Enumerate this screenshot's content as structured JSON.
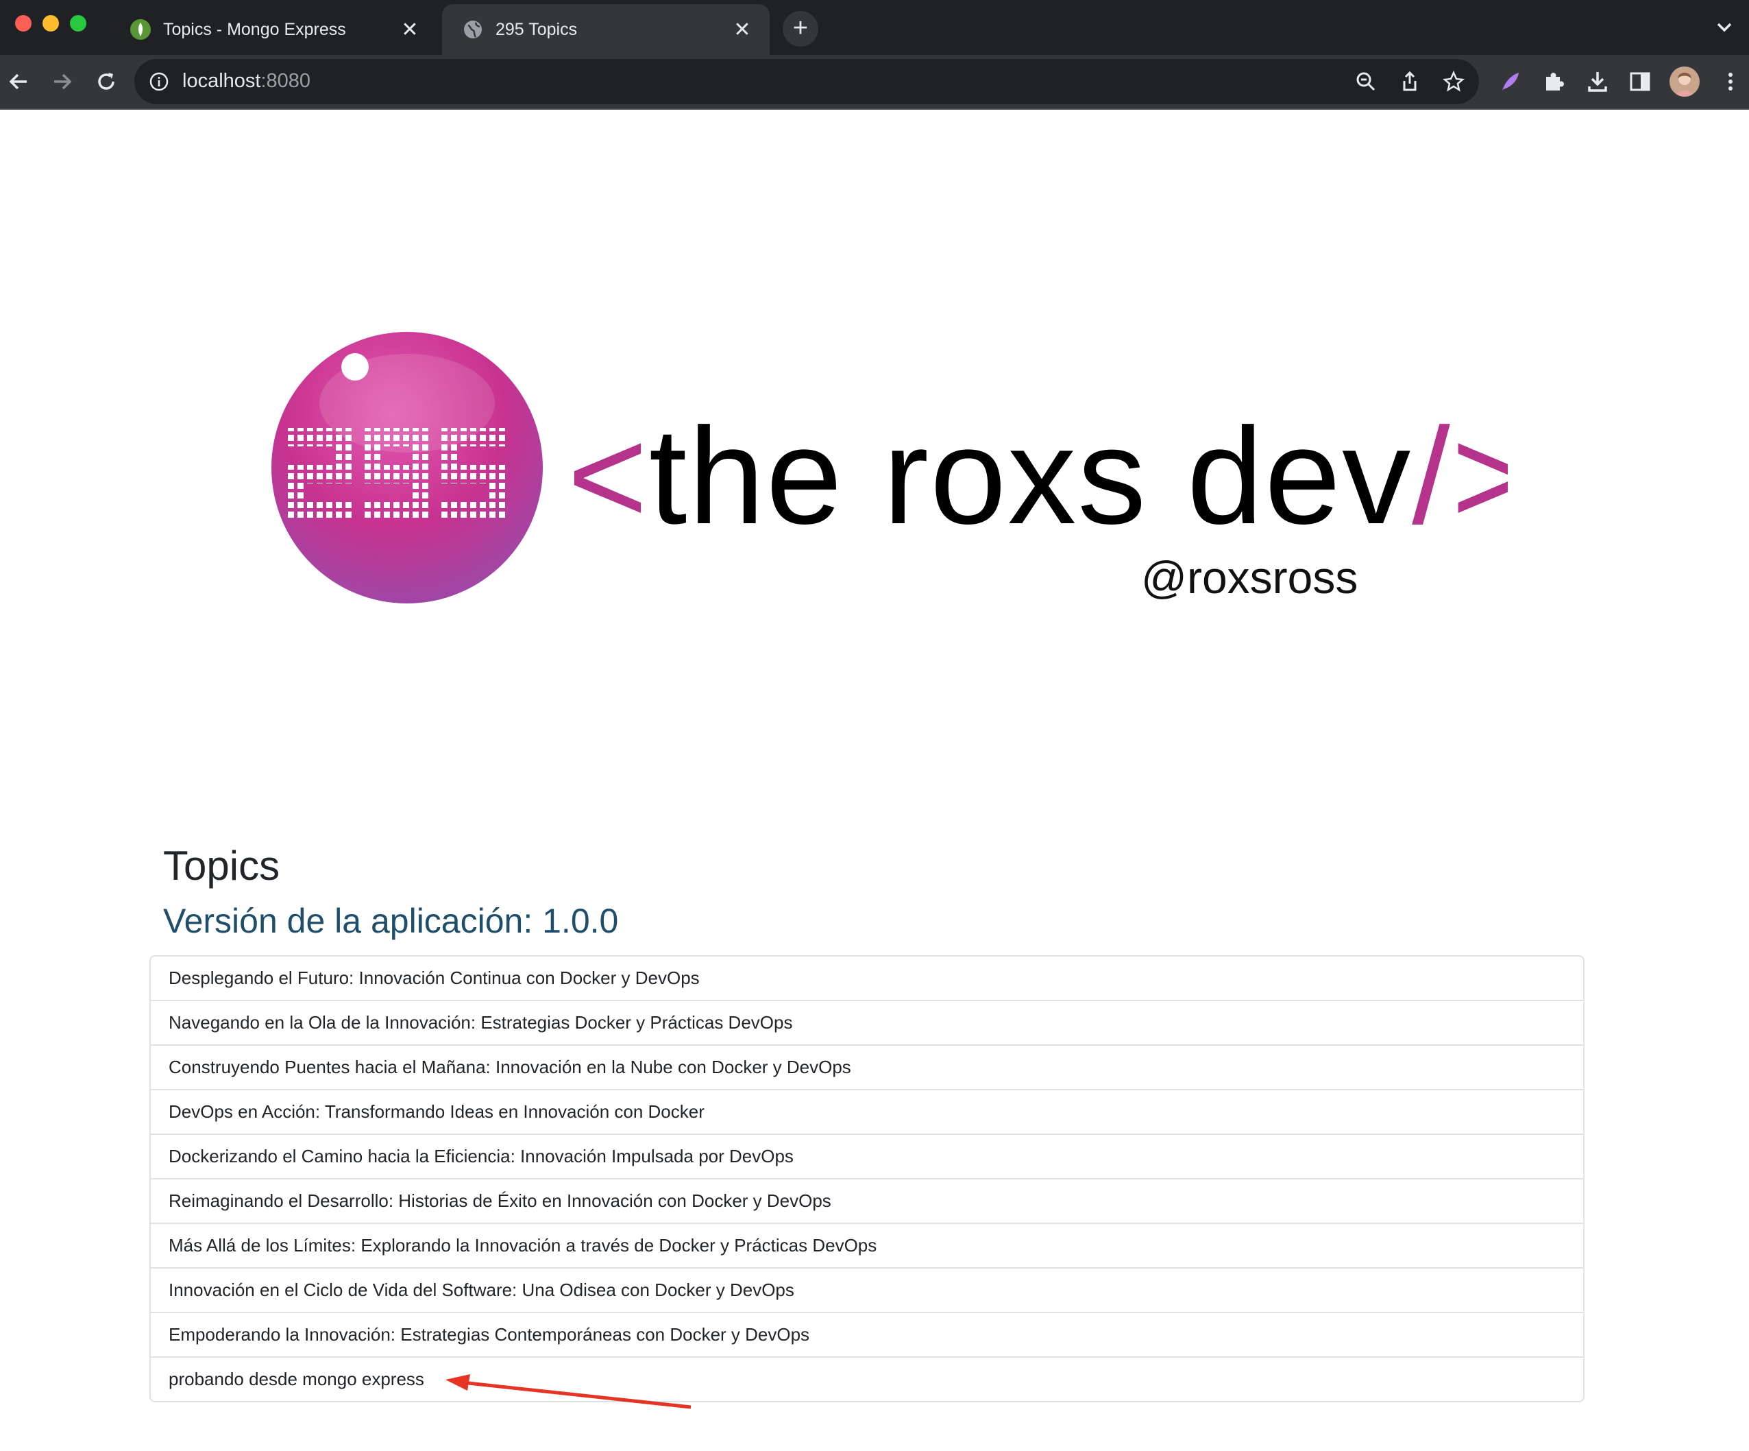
{
  "browser": {
    "tabs": [
      {
        "title": "Topics - Mongo Express",
        "favicon": "mongo-leaf-icon",
        "active": false
      },
      {
        "title": "295 Topics",
        "favicon": "globe-icon",
        "active": true
      }
    ],
    "address": {
      "host": "localhost",
      "port": ":8080"
    },
    "colors": {
      "tab_bar": "#202124",
      "toolbar": "#35363a"
    }
  },
  "banner": {
    "logo": "295-circle-logo",
    "brand_text": "<the roxs dev/>",
    "handle": "@roxsross",
    "accent_color": "#b5338a"
  },
  "page": {
    "heading": "Topics",
    "version": "Versión de la aplicación: 1.0.0",
    "topics": [
      "Desplegando el Futuro: Innovación Continua con Docker y DevOps",
      "Navegando en la Ola de la Innovación: Estrategias Docker y Prácticas DevOps",
      "Construyendo Puentes hacia el Mañana: Innovación en la Nube con Docker y DevOps",
      "DevOps en Acción: Transformando Ideas en Innovación con Docker",
      "Dockerizando el Camino hacia la Eficiencia: Innovación Impulsada por DevOps",
      "Reimaginando el Desarrollo: Historias de Éxito en Innovación con Docker y DevOps",
      "Más Allá de los Límites: Explorando la Innovación a través de Docker y Prácticas DevOps",
      "Innovación en el Ciclo de Vida del Software: Una Odisea con Docker y DevOps",
      "Empoderando la Innovación: Estrategias Contemporáneas con Docker y DevOps",
      "probando desde mongo express"
    ],
    "annotation": {
      "type": "red-arrow",
      "color": "#e53324"
    }
  }
}
